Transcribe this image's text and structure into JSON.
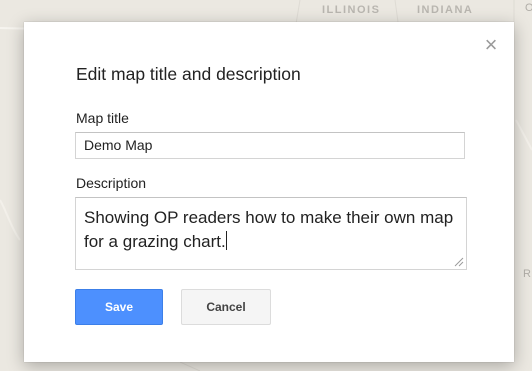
{
  "map": {
    "labels": [
      "ILLINOIS",
      "INDIANA"
    ],
    "edge_letters": [
      "O",
      "R"
    ]
  },
  "dialog": {
    "close_icon": "×",
    "title": "Edit map title and description",
    "map_title_label": "Map title",
    "map_title_value": "Demo Map",
    "description_label": "Description",
    "description_value": "Showing OP readers how to make their own map for a grazing chart.",
    "save_label": "Save",
    "cancel_label": "Cancel"
  },
  "colors": {
    "save_button": "#4d90fe",
    "cancel_button": "#f5f5f5",
    "map_background": "#ebe8e1"
  }
}
